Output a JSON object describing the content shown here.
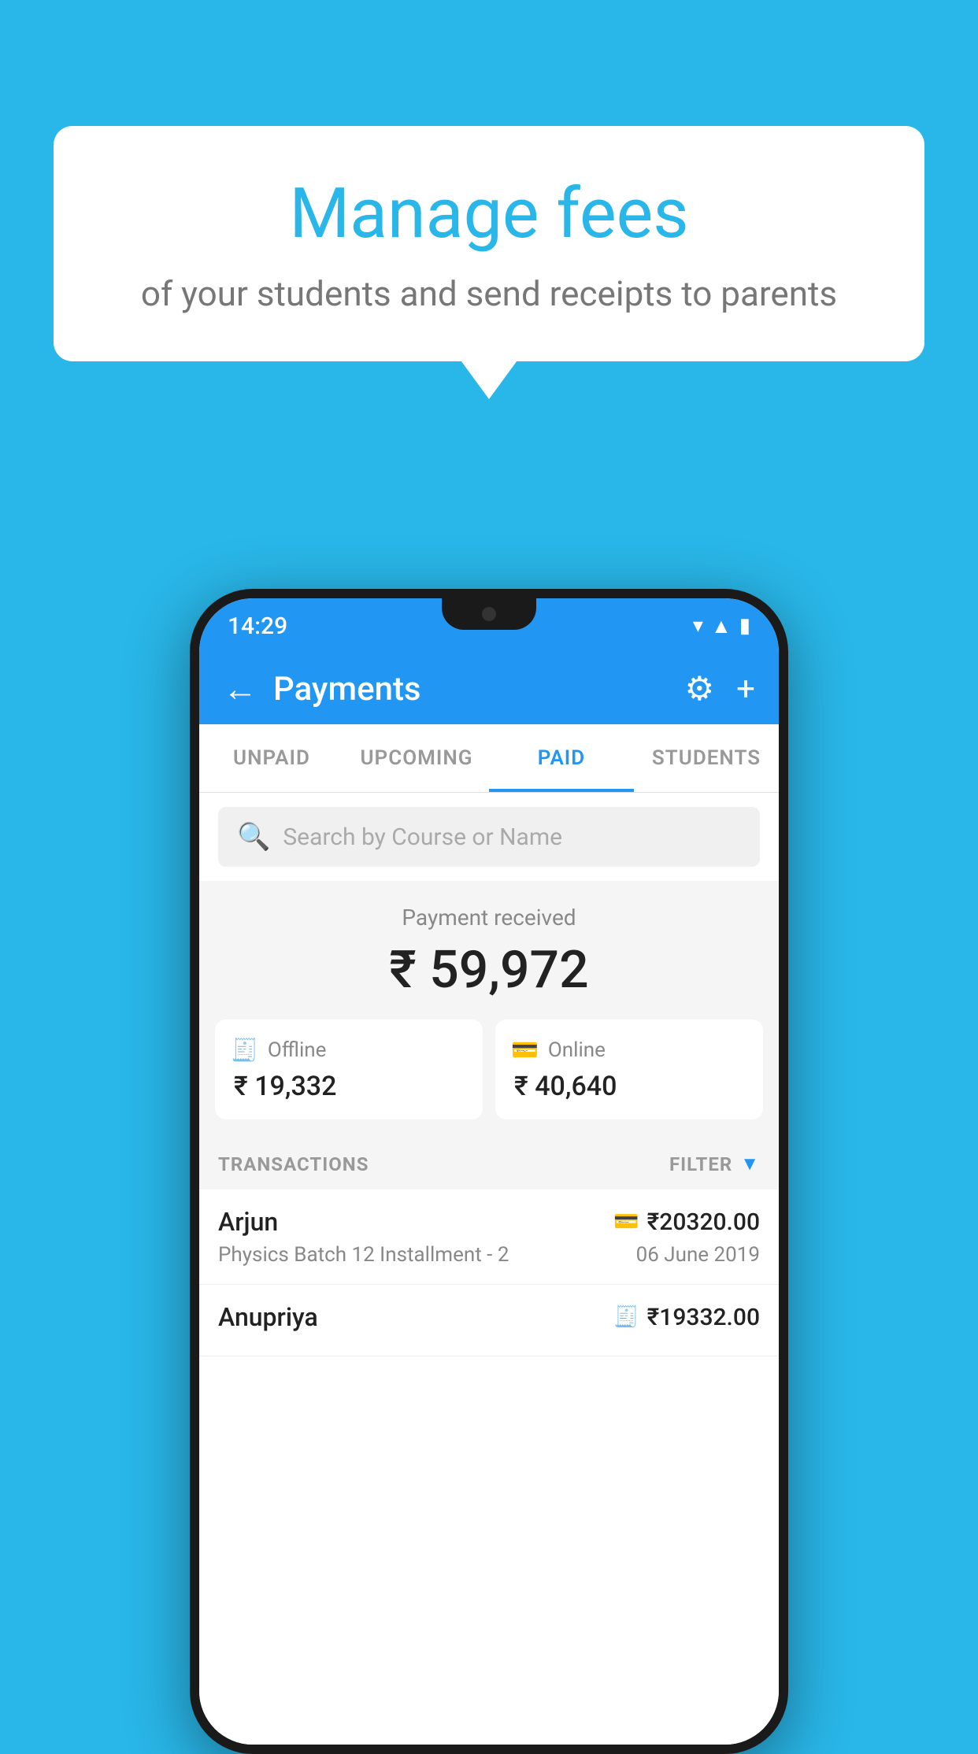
{
  "background": {
    "color": "#29b6e8"
  },
  "speech_bubble": {
    "title": "Manage fees",
    "subtitle": "of your students and send receipts to parents"
  },
  "status_bar": {
    "time": "14:29",
    "wifi_icon": "▾",
    "signal_icon": "▲",
    "battery_icon": "▮"
  },
  "app_bar": {
    "back_label": "←",
    "title": "Payments",
    "gear_icon": "⚙",
    "plus_icon": "+"
  },
  "tabs": [
    {
      "label": "UNPAID",
      "active": false
    },
    {
      "label": "UPCOMING",
      "active": false
    },
    {
      "label": "PAID",
      "active": true
    },
    {
      "label": "STUDENTS",
      "active": false
    }
  ],
  "search": {
    "placeholder": "Search by Course or Name",
    "icon": "🔍"
  },
  "payment_summary": {
    "label": "Payment received",
    "total_amount": "₹ 59,972",
    "offline": {
      "label": "Offline",
      "amount": "₹ 19,332",
      "icon": "💳"
    },
    "online": {
      "label": "Online",
      "amount": "₹ 40,640",
      "icon": "💳"
    }
  },
  "transactions_section": {
    "label": "TRANSACTIONS",
    "filter_label": "FILTER",
    "filter_icon": "▼"
  },
  "transactions": [
    {
      "name": "Arjun",
      "course": "Physics Batch 12 Installment - 2",
      "amount": "₹20320.00",
      "date": "06 June 2019",
      "payment_type": "online"
    },
    {
      "name": "Anupriya",
      "course": "",
      "amount": "₹19332.00",
      "date": "",
      "payment_type": "offline"
    }
  ]
}
